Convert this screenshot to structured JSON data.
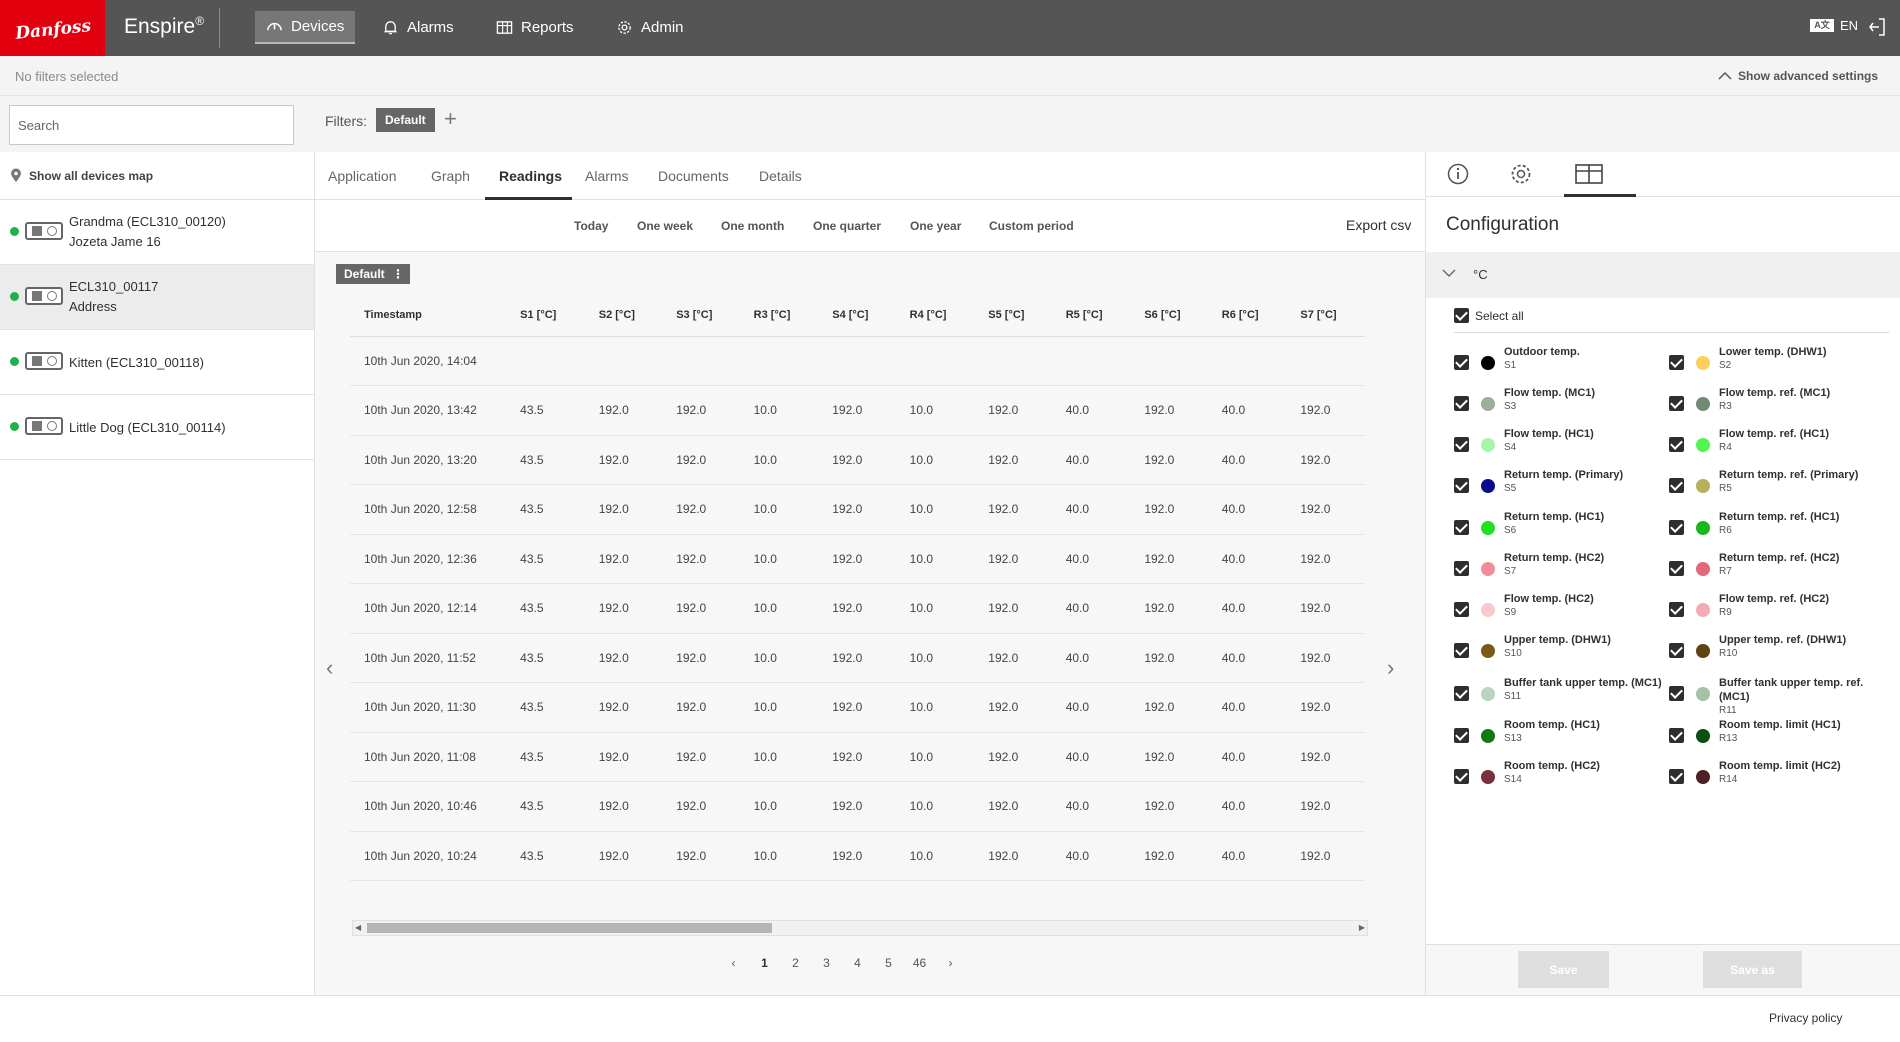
{
  "header": {
    "logo_text": "Danfoss",
    "product": "Enspire",
    "product_mark": "®",
    "nav": [
      {
        "label": "Devices",
        "icon": "gauge-icon",
        "active": true
      },
      {
        "label": "Alarms",
        "icon": "bell-icon",
        "active": false
      },
      {
        "label": "Reports",
        "icon": "table-icon",
        "active": false
      },
      {
        "label": "Admin",
        "icon": "gear-icon",
        "active": false
      }
    ],
    "language_glyph": "A文",
    "language": "EN"
  },
  "filter_bar": {
    "status": "No filters selected",
    "advanced": "Show advanced settings"
  },
  "search": {
    "placeholder": "Search",
    "value": ""
  },
  "filters": {
    "label": "Filters:",
    "chip": "Default",
    "add": "+"
  },
  "left": {
    "map_button": "Show all devices map",
    "devices": [
      {
        "name": "Grandma (ECL310_00120)",
        "address": "Jozeta Jame 16",
        "online": true
      },
      {
        "name": "ECL310_00117",
        "address": "Address",
        "online": true
      },
      {
        "name": "Kitten (ECL310_00118)",
        "address": "",
        "online": true
      },
      {
        "name": "Little Dog (ECL310_00114)",
        "address": "",
        "online": true
      }
    ]
  },
  "tabs": [
    "Application",
    "Graph",
    "Readings",
    "Alarms",
    "Documents",
    "Details"
  ],
  "active_tab": "Readings",
  "periods": [
    "Today",
    "One week",
    "One month",
    "One quarter",
    "One year",
    "Custom period"
  ],
  "export": "Export csv",
  "table": {
    "preset": "Default",
    "preset_menu": "⋮",
    "columns": [
      "Timestamp",
      "S1 [°C]",
      "S2 [°C]",
      "S3 [°C]",
      "R3 [°C]",
      "S4 [°C]",
      "R4 [°C]",
      "S5 [°C]",
      "R5 [°C]",
      "S6 [°C]",
      "R6 [°C]",
      "S7 [°C]"
    ],
    "rows": [
      [
        "10th Jun 2020, 14:04",
        "",
        "",
        "",
        "",
        "",
        "",
        "",
        "",
        "",
        "",
        ""
      ],
      [
        "10th Jun 2020, 13:42",
        "43.5",
        "192.0",
        "192.0",
        "10.0",
        "192.0",
        "10.0",
        "192.0",
        "40.0",
        "192.0",
        "40.0",
        "192.0"
      ],
      [
        "10th Jun 2020, 13:20",
        "43.5",
        "192.0",
        "192.0",
        "10.0",
        "192.0",
        "10.0",
        "192.0",
        "40.0",
        "192.0",
        "40.0",
        "192.0"
      ],
      [
        "10th Jun 2020, 12:58",
        "43.5",
        "192.0",
        "192.0",
        "10.0",
        "192.0",
        "10.0",
        "192.0",
        "40.0",
        "192.0",
        "40.0",
        "192.0"
      ],
      [
        "10th Jun 2020, 12:36",
        "43.5",
        "192.0",
        "192.0",
        "10.0",
        "192.0",
        "10.0",
        "192.0",
        "40.0",
        "192.0",
        "40.0",
        "192.0"
      ],
      [
        "10th Jun 2020, 12:14",
        "43.5",
        "192.0",
        "192.0",
        "10.0",
        "192.0",
        "10.0",
        "192.0",
        "40.0",
        "192.0",
        "40.0",
        "192.0"
      ],
      [
        "10th Jun 2020, 11:52",
        "43.5",
        "192.0",
        "192.0",
        "10.0",
        "192.0",
        "10.0",
        "192.0",
        "40.0",
        "192.0",
        "40.0",
        "192.0"
      ],
      [
        "10th Jun 2020, 11:30",
        "43.5",
        "192.0",
        "192.0",
        "10.0",
        "192.0",
        "10.0",
        "192.0",
        "40.0",
        "192.0",
        "40.0",
        "192.0"
      ],
      [
        "10th Jun 2020, 11:08",
        "43.5",
        "192.0",
        "192.0",
        "10.0",
        "192.0",
        "10.0",
        "192.0",
        "40.0",
        "192.0",
        "40.0",
        "192.0"
      ],
      [
        "10th Jun 2020, 10:46",
        "43.5",
        "192.0",
        "192.0",
        "10.0",
        "192.0",
        "10.0",
        "192.0",
        "40.0",
        "192.0",
        "40.0",
        "192.0"
      ],
      [
        "10th Jun 2020, 10:24",
        "43.5",
        "192.0",
        "192.0",
        "10.0",
        "192.0",
        "10.0",
        "192.0",
        "40.0",
        "192.0",
        "40.0",
        "192.0"
      ]
    ],
    "prev_arrow": "‹",
    "next_arrow": "›",
    "horizontal_scroll_fraction": 0.41
  },
  "pagination": {
    "prev": "‹",
    "pages": [
      "1",
      "2",
      "3",
      "4",
      "5",
      "46"
    ],
    "current": "1",
    "next": "›"
  },
  "config": {
    "title": "Configuration",
    "unit": "°C",
    "select_all": "Select all",
    "sensors": [
      {
        "label": "Outdoor temp.",
        "id": "S1",
        "color": "#000000",
        "checked": true
      },
      {
        "label": "Lower temp. (DHW1)",
        "id": "S2",
        "color": "#ffcf5c",
        "checked": true
      },
      {
        "label": "Flow temp. (MC1)",
        "id": "S3",
        "color": "#9bb09a",
        "checked": true
      },
      {
        "label": "Flow temp. ref. (MC1)",
        "id": "R3",
        "color": "#6f8b73",
        "checked": true
      },
      {
        "label": "Flow temp. (HC1)",
        "id": "S4",
        "color": "#a6f5a6",
        "checked": true
      },
      {
        "label": "Flow temp. ref. (HC1)",
        "id": "R4",
        "color": "#53f553",
        "checked": true
      },
      {
        "label": "Return temp. (Primary)",
        "id": "S5",
        "color": "#0b0b8f",
        "checked": true
      },
      {
        "label": "Return temp. ref. (Primary)",
        "id": "R5",
        "color": "#b3b25a",
        "checked": true
      },
      {
        "label": "Return temp. (HC1)",
        "id": "S6",
        "color": "#22e022",
        "checked": true
      },
      {
        "label": "Return temp. ref. (HC1)",
        "id": "R6",
        "color": "#19b719",
        "checked": true
      },
      {
        "label": "Return temp. (HC2)",
        "id": "S7",
        "color": "#f08e9c",
        "checked": true
      },
      {
        "label": "Return temp. ref. (HC2)",
        "id": "R7",
        "color": "#e06a7c",
        "checked": true
      },
      {
        "label": "Flow temp. (HC2)",
        "id": "S9",
        "color": "#f9c9d0",
        "checked": true
      },
      {
        "label": "Flow temp. ref. (HC2)",
        "id": "R9",
        "color": "#f4aab5",
        "checked": true
      },
      {
        "label": "Upper temp. (DHW1)",
        "id": "S10",
        "color": "#7b5a16",
        "checked": true
      },
      {
        "label": "Upper temp. ref. (DHW1)",
        "id": "R10",
        "color": "#5c4513",
        "checked": true
      },
      {
        "label": "Buffer tank upper temp. (MC1)",
        "id": "S11",
        "color": "#b9d4bb",
        "checked": true
      },
      {
        "label": "Buffer tank upper temp. ref. (MC1)",
        "id": "R11",
        "color": "#a3c2a6",
        "checked": true
      },
      {
        "label": "Room temp. (HC1)",
        "id": "S13",
        "color": "#0f7a14",
        "checked": true
      },
      {
        "label": "Room temp. limit (HC1)",
        "id": "R13",
        "color": "#0a5010",
        "checked": true
      },
      {
        "label": "Room temp. (HC2)",
        "id": "S14",
        "color": "#7a3139",
        "checked": true
      },
      {
        "label": "Room temp. limit (HC2)",
        "id": "R14",
        "color": "#4e1f25",
        "checked": true
      }
    ],
    "save": "Save",
    "save_as": "Save as"
  },
  "footer": {
    "privacy": "Privacy policy"
  }
}
